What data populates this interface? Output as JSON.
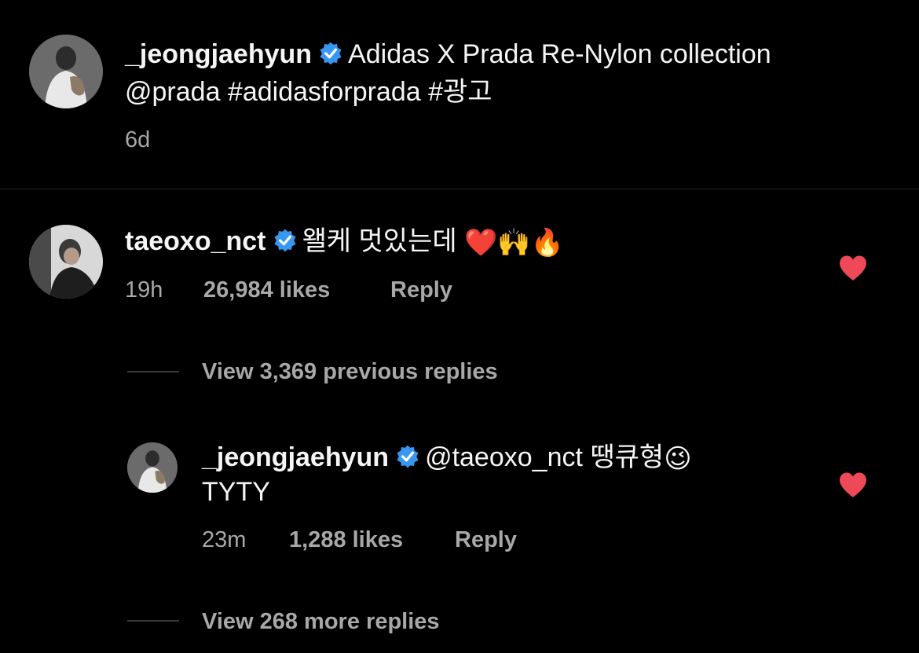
{
  "caption": {
    "username": "_jeongjaehyun",
    "text_line1": "Adidas X Prada Re-Nylon collection",
    "text_line2": "@prada #adidasforprada #광고",
    "time": "6d"
  },
  "comment": {
    "username": "taeoxo_nct",
    "text": "왤케 멋있는데",
    "emojis": "❤️🙌🔥",
    "time": "19h",
    "likes": "26,984 likes",
    "reply_label": "Reply",
    "liked": true
  },
  "view_previous": "View 3,369 previous replies",
  "reply": {
    "username": "_jeongjaehyun",
    "text": "@taeoxo_nct 땡큐형",
    "emoji": "😉",
    "text_line2": "TYTY",
    "time": "23m",
    "likes": "1,288 likes",
    "reply_label": "Reply",
    "liked": true
  },
  "view_more": "View 268 more replies",
  "colors": {
    "background": "#000000",
    "text": "#f5f5f5",
    "secondary": "#a8a8a8",
    "verified": "#3897f0",
    "heart": "#ed4956"
  },
  "icons": {
    "verified": "verified-badge-icon",
    "heart": "heart-filled-icon"
  }
}
